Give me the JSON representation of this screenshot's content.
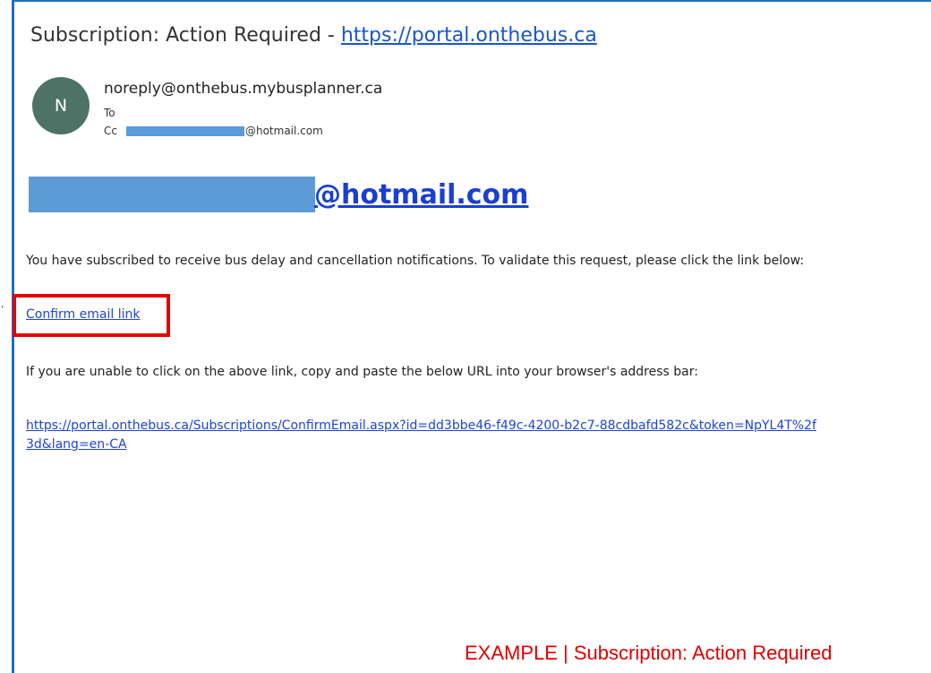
{
  "email": {
    "subject_prefix": "Subscription: Action Required - ",
    "subject_link": "https://portal.onthebus.ca",
    "avatar_initial": "N",
    "sender": "noreply@onthebus.mybusplanner.ca",
    "to_label": "To",
    "cc_label": "Cc",
    "cc_suffix": "@hotmail.com",
    "recipient_suffix": "@hotmail.com",
    "body_intro": "You have subscribed to receive bus delay and cancellation notifications. To validate this request, please click the link below:",
    "confirm_link": "Confirm email link",
    "body_fallback": "If you are unable to click on the above link, copy and paste the below URL into your browser's address bar:",
    "url_line1": "https://portal.onthebus.ca/Subscriptions/ConfirmEmail.aspx?id=dd3bbe46-f49c-4200-b2c7-88cdbafd582c&token=NpYL4T%2f",
    "url_line2": "3d&lang=en-CA"
  },
  "caption": "EXAMPLE | Subscription: Action Required",
  "colors": {
    "frame": "#1f6fbf",
    "redaction": "#5c9bd8",
    "highlight": "#e60000",
    "link": "#1d44d6",
    "avatar": "#4d7266"
  }
}
